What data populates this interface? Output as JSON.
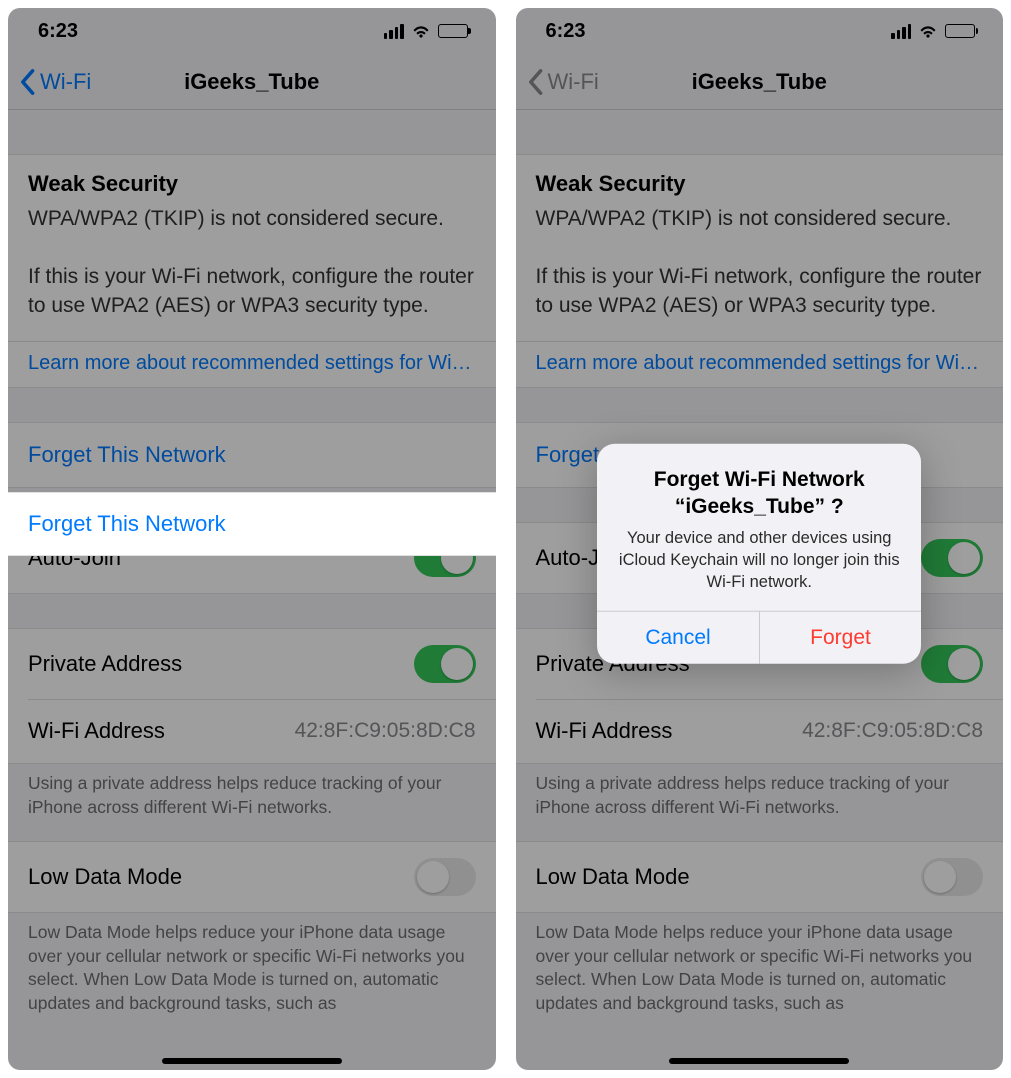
{
  "status": {
    "time": "6:23"
  },
  "nav": {
    "back_label": "Wi-Fi",
    "title": "iGeeks_Tube"
  },
  "security": {
    "heading": "Weak Security",
    "body": "WPA/WPA2 (TKIP) is not considered secure.\n\nIf this is your Wi-Fi network, configure the router to use WPA2 (AES) or WPA3 security type.",
    "learn_more": "Learn more about recommended settings for Wi-Fi..."
  },
  "forget_label": "Forget This Network",
  "rows": {
    "auto_join": {
      "label": "Auto-Join",
      "on": true
    },
    "private_address": {
      "label": "Private Address",
      "on": true
    },
    "wifi_address": {
      "label": "Wi-Fi Address",
      "value": "42:8F:C9:05:8D:C8"
    },
    "private_note": "Using a private address helps reduce tracking of your iPhone across different Wi-Fi networks.",
    "low_data": {
      "label": "Low Data Mode",
      "on": false
    },
    "low_data_note": "Low Data Mode helps reduce your iPhone data usage over your cellular network or specific Wi-Fi networks you select. When Low Data Mode is turned on, automatic updates and background tasks, such as"
  },
  "alert": {
    "title": "Forget Wi-Fi Network\n“iGeeks_Tube” ?",
    "message": "Your device and other devices using iCloud Keychain will no longer join this Wi-Fi network.",
    "cancel": "Cancel",
    "forget": "Forget"
  }
}
